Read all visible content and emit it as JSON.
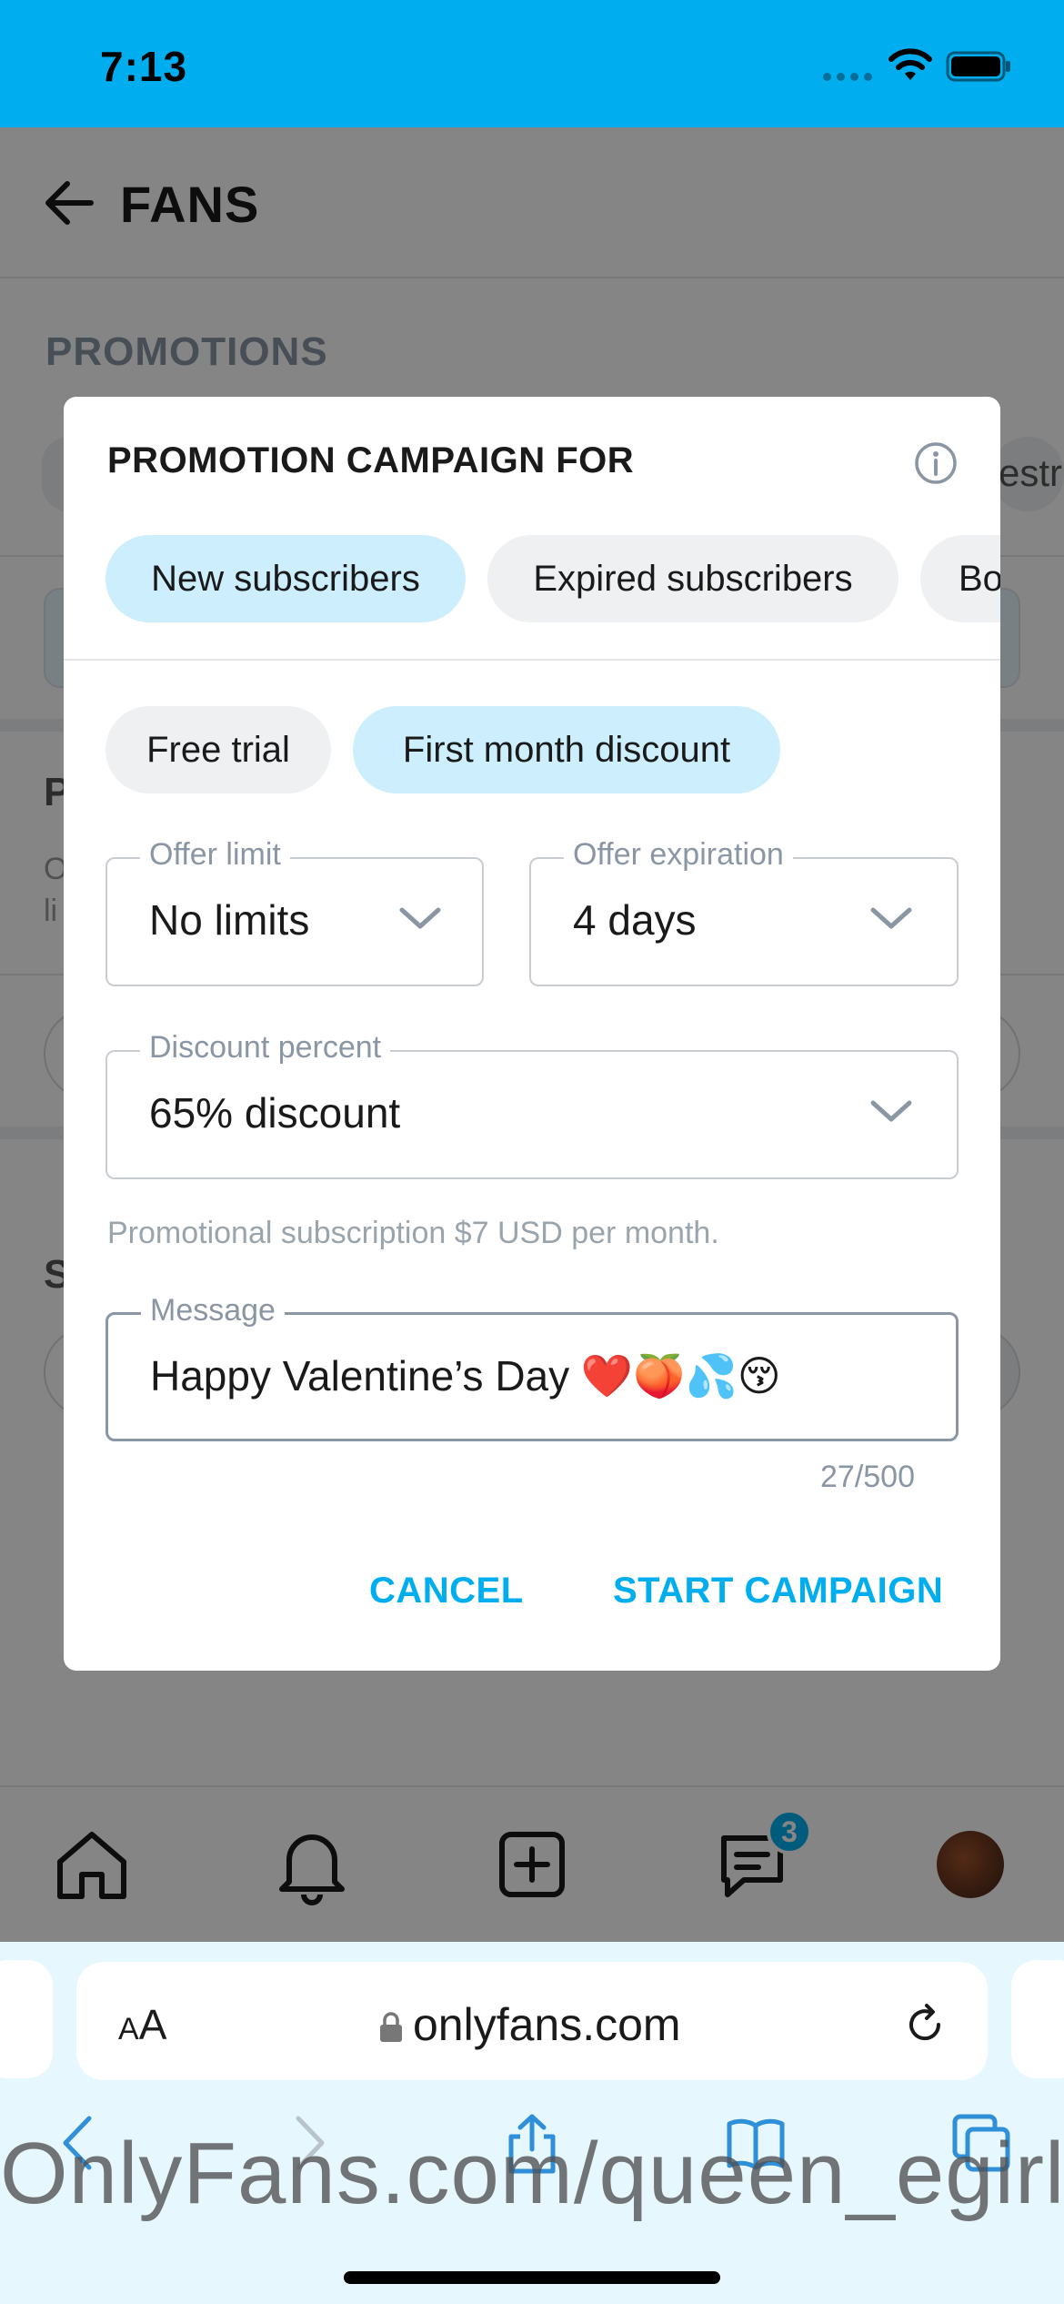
{
  "status_bar": {
    "time": "7:13"
  },
  "page": {
    "title": "FANS",
    "section_label": "PROMOTIONS",
    "peek_text": "estr",
    "peek_p": "P",
    "peek_o": "O",
    "peek_li": "li",
    "peek_s": "S"
  },
  "modal": {
    "title": "PROMOTION CAMPAIGN FOR",
    "audience_chips": [
      {
        "label": "New subscribers",
        "active": true
      },
      {
        "label": "Expired subscribers",
        "active": false
      },
      {
        "label": "Bo",
        "active": false
      }
    ],
    "offer_types": [
      {
        "label": "Free trial",
        "active": false
      },
      {
        "label": "First month discount",
        "active": true
      }
    ],
    "offer_limit": {
      "label": "Offer limit",
      "value": "No limits"
    },
    "offer_expiration": {
      "label": "Offer expiration",
      "value": "4 days"
    },
    "discount_percent": {
      "label": "Discount percent",
      "value": "65% discount"
    },
    "helper_text": "Promotional subscription $7 USD per month.",
    "message": {
      "label": "Message",
      "value": "Happy Valentine’s Day ❤️🍑💦😚",
      "counter": "27/500"
    },
    "cancel_label": "CANCEL",
    "start_label": "START CAMPAIGN"
  },
  "tab_bar": {
    "icons": [
      "home-icon",
      "bell-icon",
      "add-post-icon",
      "messages-icon",
      "avatar"
    ],
    "messages_badge": "3"
  },
  "browser": {
    "text_size_label_small": "A",
    "text_size_label_large": "A",
    "url": "onlyfans.com",
    "watermark": "OnlyFans.com/queen_egirl2"
  },
  "colors": {
    "accent": "#00aeef",
    "chip_active": "#cdeefc",
    "chip_inactive": "#eef0f2"
  }
}
